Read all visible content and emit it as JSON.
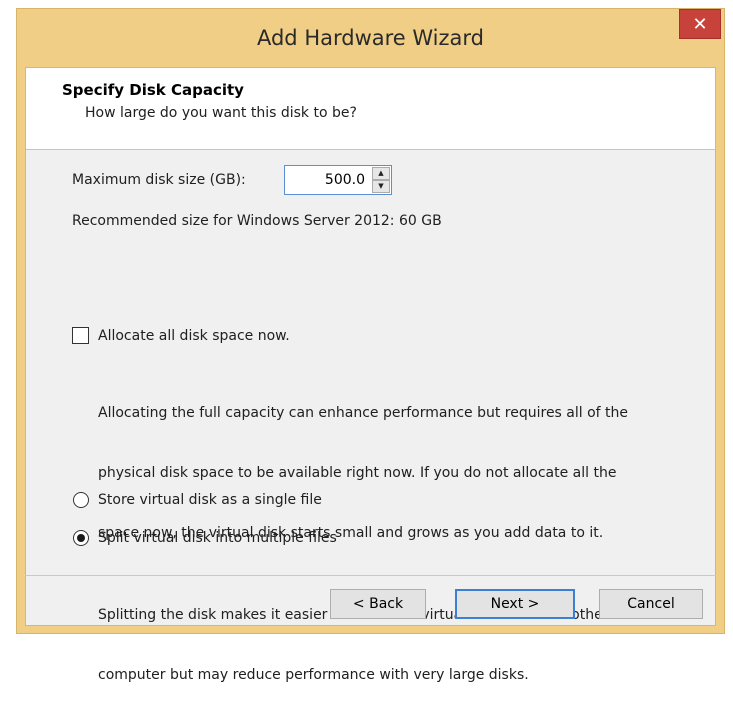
{
  "window": {
    "title": "Add Hardware Wizard",
    "close_glyph": "✕"
  },
  "header": {
    "title": "Specify Disk Capacity",
    "subtitle": "How large do you want this disk to be?"
  },
  "disk_size": {
    "label": "Maximum disk size (GB):",
    "value": "500.0"
  },
  "recommended": "Recommended size for Windows Server 2012: 60 GB",
  "allocate": {
    "label": "Allocate all disk space now.",
    "checked": false,
    "description_lines": [
      "Allocating the full capacity can enhance performance but requires all of the",
      "physical disk space to be available right now. If you do not allocate all the",
      "space now, the virtual disk starts small and grows as you add data to it."
    ]
  },
  "storage_options": {
    "single": {
      "label": "Store virtual disk as a single file",
      "selected": false
    },
    "split": {
      "label": "Split virtual disk into multiple files",
      "selected": true
    },
    "split_description_lines": [
      "Splitting the disk makes it easier to move the virtual machine to another",
      "computer but may reduce performance with very large disks."
    ]
  },
  "buttons": {
    "back": "< Back",
    "next": "Next >",
    "cancel": "Cancel"
  },
  "colors": {
    "title_bar": "#f0ce85",
    "close_button": "#c7423a",
    "default_button_border": "#3c7fd3"
  },
  "icons": {
    "close": "close-icon",
    "spin_up": "spin-up-icon",
    "spin_down": "spin-down-icon"
  }
}
